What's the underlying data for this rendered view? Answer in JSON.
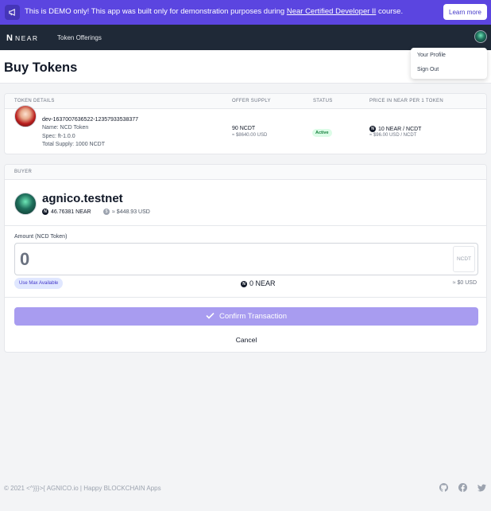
{
  "banner": {
    "text_before": "This is DEMO only! This app was built only for demonstration purposes during ",
    "link_text": "Near Certified Developer II",
    "text_after": " course.",
    "learn_more": "Learn more"
  },
  "nav": {
    "brand": "NEAR",
    "brand_mark": "N",
    "token_offerings": "Token Offerings"
  },
  "user_menu": {
    "profile": "Your Profile",
    "sign_out": "Sign Out"
  },
  "page": {
    "title": "Buy Tokens"
  },
  "token_table": {
    "headers": {
      "details": "TOKEN DETAILS",
      "supply": "OFFER SUPPLY",
      "status": "STATUS",
      "price": "PRICE IN NEAR PER 1 TOKEN"
    },
    "row": {
      "id": "dev-1637007636522-12357933538377",
      "name": "Name: NCD Token",
      "spec": "Spec: ft-1.0.0",
      "total_supply": "Total Supply: 1000 NCDT",
      "offer_supply": "90 NCDT",
      "offer_supply_usd": "≈ $8640.00 USD",
      "status": "Active",
      "price": "10 NEAR / NCDT",
      "price_usd": "≈ $96.00 USD / NCDT"
    }
  },
  "buyer": {
    "header": "BUYER",
    "name": "agnico.testnet",
    "near_balance": "46.76381 NEAR",
    "usd_balance": "≈ $448.93 USD"
  },
  "amount": {
    "label": "Amount (NCD Token)",
    "value": "0",
    "unit": "NCDT",
    "max_button": "Use Max Available",
    "near_total": "0 NEAR",
    "usd_total": "≈ $0 USD"
  },
  "actions": {
    "confirm": "Confirm Transaction",
    "cancel": "Cancel"
  },
  "footer": {
    "text": "© 2021 <^}}}>{ AGNICO.io | Happy BLOCKCHAIN Apps"
  },
  "colors": {
    "banner": "#5b45e0",
    "navbar": "#1f2937",
    "confirm_button": "#a89cf0",
    "active_badge": "#dcfce7"
  }
}
